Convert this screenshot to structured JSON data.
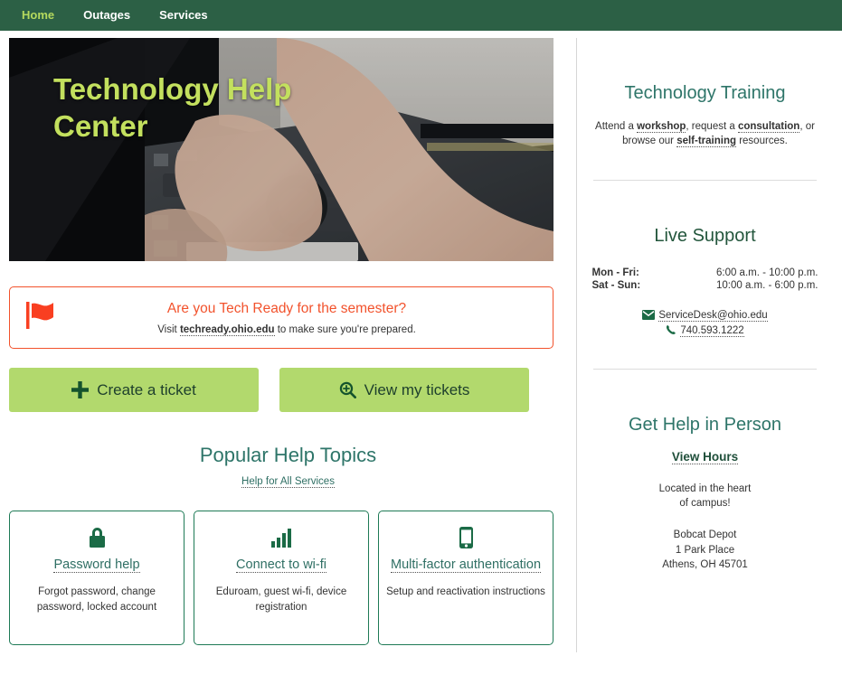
{
  "nav": {
    "items": [
      {
        "label": "Home",
        "active": true
      },
      {
        "label": "Outages",
        "active": false
      },
      {
        "label": "Services",
        "active": false
      }
    ]
  },
  "hero": {
    "title": "Technology Help Center",
    "image_alt": "hands-repairing-laptop-photo"
  },
  "alert": {
    "icon": "flag-icon",
    "accent_color": "#f2522c",
    "title": "Are you Tech Ready for the semester?",
    "sub_prefix": "Visit ",
    "sub_link": "techready.ohio.edu",
    "sub_suffix": " to make sure you're prepared."
  },
  "actions": {
    "create_ticket": "Create a ticket",
    "view_tickets": "View my tickets",
    "button_color": "#b2d96d"
  },
  "topics": {
    "heading": "Popular Help Topics",
    "all_services_link": "Help for All Services",
    "cards": [
      {
        "icon": "lock-icon",
        "title": "Password help",
        "desc": "Forgot password, change password, locked account"
      },
      {
        "icon": "wifi-signal-icon",
        "title": "Connect to wi-fi",
        "desc": "Eduroam, guest wi-fi, device registration"
      },
      {
        "icon": "mobile-phone-icon",
        "title": "Multi-factor authentication",
        "desc": "Setup and reactivation instructions"
      }
    ]
  },
  "training": {
    "heading": "Technology Training",
    "text_1": "Attend a ",
    "link_workshop": "workshop",
    "text_2": ", request a ",
    "link_consultation": "consultation",
    "text_3": ", or browse our ",
    "link_self_training": "self-training",
    "text_4": " resources."
  },
  "live_support": {
    "heading": "Live Support",
    "hours": [
      {
        "days": "Mon - Fri:",
        "time": "6:00 a.m. - 10:00 p.m."
      },
      {
        "days": "Sat - Sun:",
        "time": "10:00 a.m. - 6:00 p.m."
      }
    ],
    "email": "ServiceDesk@ohio.edu",
    "email_icon": "envelope-icon",
    "phone": "740.593.1222",
    "phone_icon": "phone-icon"
  },
  "in_person": {
    "heading": "Get Help in Person",
    "view_hours": "View Hours",
    "blurb_line1": "Located in the heart",
    "blurb_line2": "of campus!",
    "addr_line1": "Bobcat Depot",
    "addr_line2": "1 Park Place",
    "addr_line3": "Athens, OH 45701"
  }
}
